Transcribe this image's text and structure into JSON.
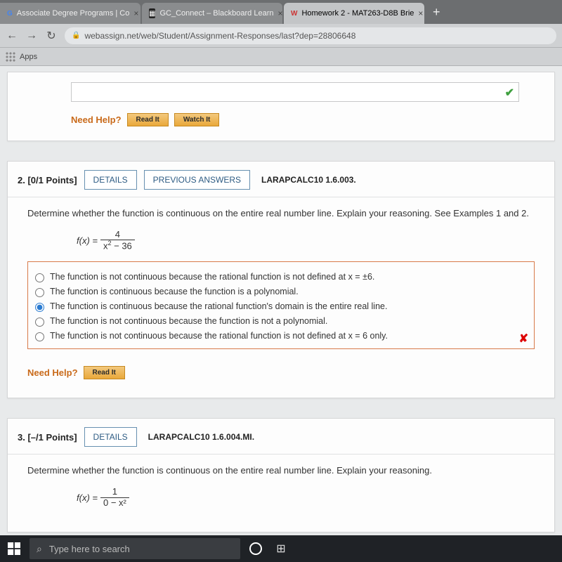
{
  "browser": {
    "tabs": [
      {
        "label": "Associate Degree Programs | Co",
        "favicon": "G"
      },
      {
        "label": "GC_Connect – Blackboard Learn",
        "favicon": "▦"
      },
      {
        "label": "Homework 2 - MAT263-D8B Brie",
        "favicon": "W"
      }
    ],
    "add_tab": "+",
    "nav": {
      "back": "←",
      "forward": "→",
      "reload": "↻"
    },
    "lock": "🔒",
    "url": "webassign.net/web/Student/Assignment-Responses/last?dep=28806648",
    "bookmarks": {
      "apps_label": "Apps"
    }
  },
  "q1": {
    "check": "✔",
    "need_help": "Need Help?",
    "read": "Read It",
    "watch": "Watch It"
  },
  "q2": {
    "number": "2.",
    "points": "[0/1 Points]",
    "details": "DETAILS",
    "prev": "PREVIOUS ANSWERS",
    "ref": "LARAPCALC10 1.6.003.",
    "prompt": "Determine whether the function is continuous on the entire real number line. Explain your reasoning. See Examples 1 and 2.",
    "func_lhs": "f(x) = ",
    "frac_num": "4",
    "frac_den_a": "x",
    "frac_den_b": " − 36",
    "opts": [
      "The function is not continuous because the rational function is not defined at x = ±6.",
      "The function is continuous because the function is a polynomial.",
      "The function is continuous because the rational function's domain is the entire real line.",
      "The function is not continuous because the function is not a polynomial.",
      "The function is not continuous because the rational function is not defined at x = 6 only."
    ],
    "selected_index": 2,
    "wrong": "✘",
    "need_help": "Need Help?",
    "read": "Read It"
  },
  "q3": {
    "number": "3.",
    "points": "[–/1 Points]",
    "details": "DETAILS",
    "ref": "LARAPCALC10 1.6.004.MI.",
    "prompt": "Determine whether the function is continuous on the entire real number line. Explain your reasoning.",
    "func_lhs": "f(x) = ",
    "frac_num": "1",
    "frac_den": "0 − x²"
  },
  "taskbar": {
    "search_placeholder": "Type here to search"
  }
}
